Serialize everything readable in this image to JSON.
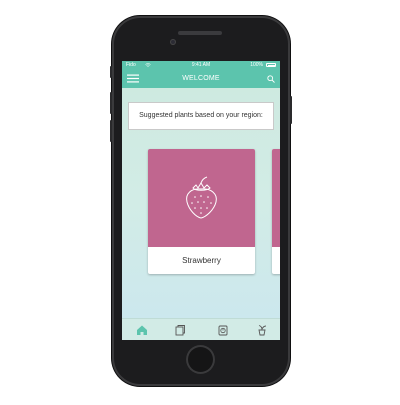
{
  "status_bar": {
    "carrier": "Fido",
    "time": "9:41 AM",
    "battery": "100%"
  },
  "app_bar": {
    "title": "WELCOME",
    "menu_icon": "menu-icon",
    "search_icon": "search-icon"
  },
  "banner": {
    "text": "Suggested plants based on your region:"
  },
  "cards": [
    {
      "label": "Strawberry",
      "icon": "strawberry-icon",
      "color": "#c0668f"
    }
  ],
  "tab_bar": {
    "tabs": [
      {
        "icon": "home-icon",
        "active": true
      },
      {
        "icon": "book-icon",
        "active": false
      },
      {
        "icon": "timer-icon",
        "active": false
      },
      {
        "icon": "plant-pot-icon",
        "active": false
      }
    ]
  },
  "colors": {
    "accent": "#5cc4ad",
    "card": "#c0668f",
    "background_top": "#cde9df",
    "background_bottom": "#cbe7ef"
  }
}
